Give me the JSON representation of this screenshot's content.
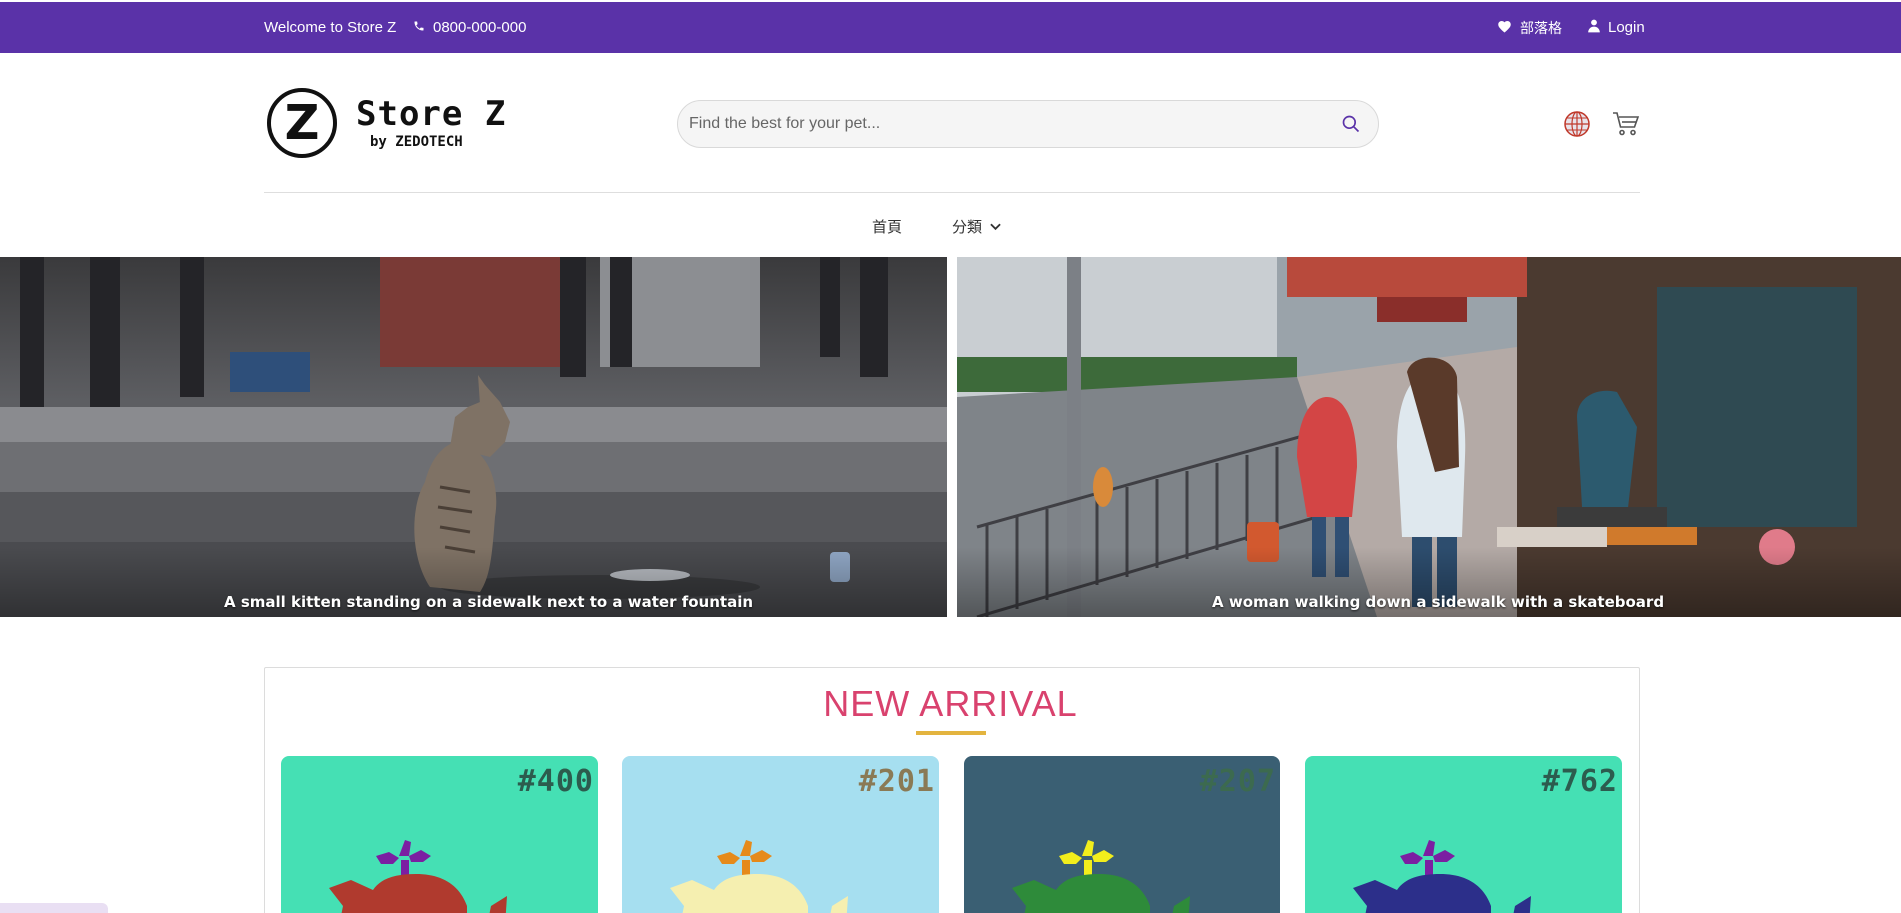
{
  "topbar": {
    "welcome": "Welcome to Store Z",
    "phone": "0800-000-000",
    "blog": "部落格",
    "login": "Login",
    "bg_color": "#5a32a8"
  },
  "header": {
    "logo_letter": "Z",
    "logo_title": "Store Z",
    "logo_sub": "by ZEDOTECH",
    "search_placeholder": "Find the best for your pet...",
    "icons": [
      "phone-icon",
      "heart-icon",
      "user-icon",
      "search-icon",
      "globe-icon",
      "cart-icon"
    ]
  },
  "nav": {
    "home": "首頁",
    "categories": "分類"
  },
  "banners": [
    {
      "caption": "A small kitten standing on a sidewalk next to a water fountain"
    },
    {
      "caption": "A woman walking down a sidewalk with a skateboard"
    }
  ],
  "new_arrival": {
    "title": "NEW ARRIVAL",
    "title_color": "#d9426e",
    "underline_color": "#e3b43f",
    "cards": [
      {
        "number": "#400",
        "bg": "#45e0b4",
        "number_color": "#2c5c4e",
        "whale": "#b03a2e",
        "leaf": "#7b1fa2"
      },
      {
        "number": "#201",
        "bg": "#a6dff0",
        "number_color": "#8a7a55",
        "whale": "#f5efb0",
        "leaf": "#e68a1a"
      },
      {
        "number": "#207",
        "bg": "#3a5f73",
        "number_color": "#3c6a4f",
        "whale": "#2e8b3a",
        "leaf": "#f2ee1c"
      },
      {
        "number": "#762",
        "bg": "#45e0b4",
        "number_color": "#2c5c4e",
        "whale": "#2c2f8a",
        "leaf": "#7b1fa2"
      }
    ]
  }
}
